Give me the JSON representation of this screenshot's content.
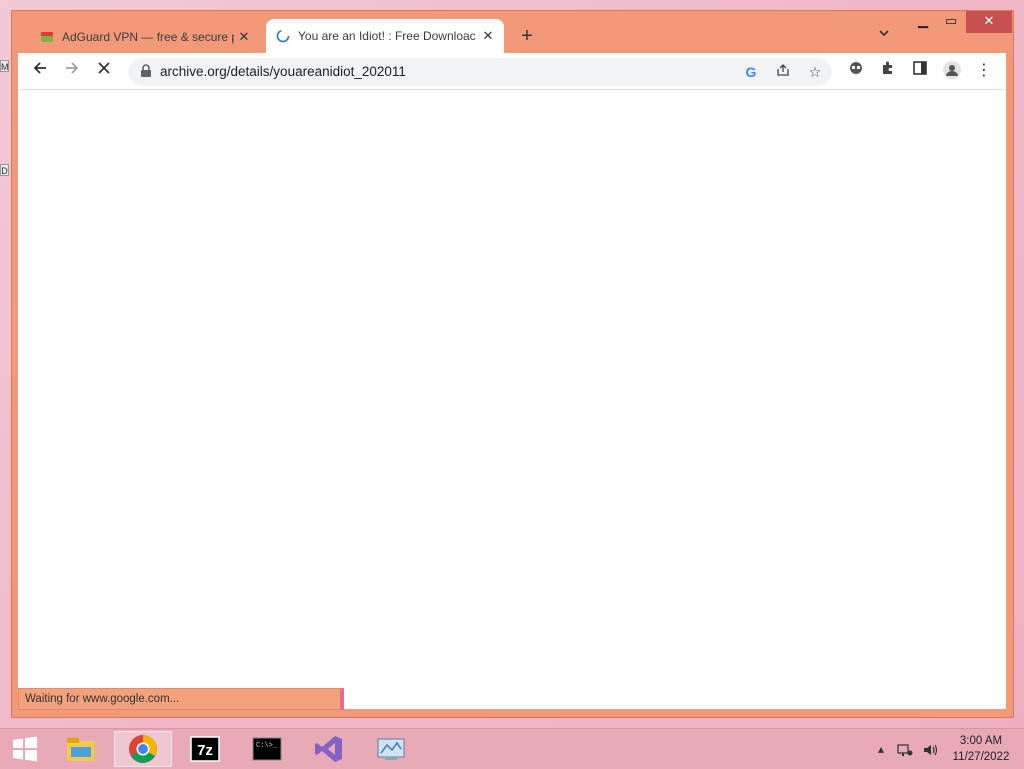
{
  "browser": {
    "tabs": [
      {
        "title": "AdGuard VPN — free & secure p",
        "active": false
      },
      {
        "title": "You are an Idiot! : Free Downloac",
        "active": true
      }
    ],
    "address": "archive.org/details/youareanidiot_202011",
    "status_text": "Waiting for www.google.com..."
  },
  "desktop": {
    "edge_icons": [
      "M",
      "D"
    ]
  },
  "taskbar": {
    "clock_time": "3:00 AM",
    "clock_date": "11/27/2022",
    "apps": [
      "start-button",
      "file-explorer",
      "chrome",
      "7zip",
      "command-prompt",
      "visual-studio",
      "control-panel"
    ],
    "accent": "#c75050"
  }
}
